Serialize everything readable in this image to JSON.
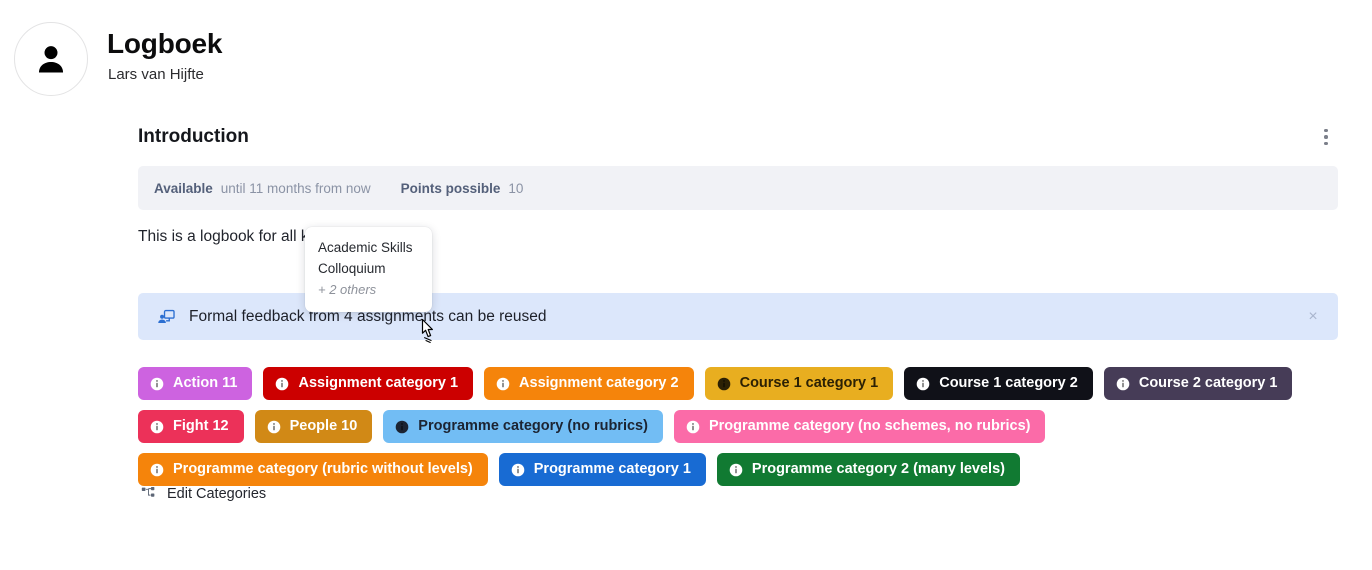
{
  "header": {
    "title": "Logboek",
    "subtitle": "Lars van Hijfte",
    "avatar_icon": "person-icon"
  },
  "section": {
    "title": "Introduction",
    "menu_icon": "kebab-menu-icon"
  },
  "meta": {
    "available_label": "Available",
    "available_value": "until 11 months from now",
    "points_label": "Points possible",
    "points_value": "10"
  },
  "description": {
    "text": "This is a logbook for all kinds of purposes"
  },
  "popover": {
    "items": [
      {
        "label": "Academic Skills"
      },
      {
        "label": "Colloquium"
      }
    ],
    "more": "+ 2 others"
  },
  "alert": {
    "icon": "peer-feedback-icon",
    "text": "Formal feedback from 4 assignments can be reused",
    "close_label": "×",
    "background": "#dce7fb"
  },
  "categories": [
    {
      "label": "Action 11",
      "bg": "#cd63e0",
      "fg": "#ffffff",
      "icon": "info-icon"
    },
    {
      "label": "Assignment category 1",
      "bg": "#cc0000",
      "fg": "#ffffff",
      "icon": "info-icon"
    },
    {
      "label": "Assignment category 2",
      "bg": "#f5840b",
      "fg": "#ffffff",
      "icon": "info-icon"
    },
    {
      "label": "Course 1 category 1",
      "bg": "#e8ae20",
      "fg": "#2c2104",
      "icon": "info-icon"
    },
    {
      "label": "Course 1 category 2",
      "bg": "#101118",
      "fg": "#ffffff",
      "icon": "info-icon"
    },
    {
      "label": "Course 2 category 1",
      "bg": "#463c57",
      "fg": "#ffffff",
      "icon": "info-icon"
    },
    {
      "label": "Fight 12",
      "bg": "#ec3159",
      "fg": "#ffffff",
      "icon": "info-icon"
    },
    {
      "label": "People 10",
      "bg": "#d18916",
      "fg": "#ffffff",
      "icon": "info-icon"
    },
    {
      "label": "Programme category (no rubrics)",
      "bg": "#72bdf4",
      "fg": "#1c2432",
      "icon": "info-icon"
    },
    {
      "label": "Programme category (no schemes, no rubrics)",
      "bg": "#fb6ba8",
      "fg": "#ffffff",
      "icon": "info-icon"
    },
    {
      "label": "Programme category (rubric without levels)",
      "bg": "#f5840b",
      "fg": "#ffffff",
      "icon": "info-icon"
    },
    {
      "label": "Programme category 1",
      "bg": "#186bd3",
      "fg": "#ffffff",
      "icon": "info-icon"
    },
    {
      "label": "Programme category 2 (many levels)",
      "bg": "#117a32",
      "fg": "#ffffff",
      "icon": "info-icon"
    }
  ],
  "edit_categories": {
    "label": "Edit Categories",
    "icon": "hierarchy-icon"
  }
}
